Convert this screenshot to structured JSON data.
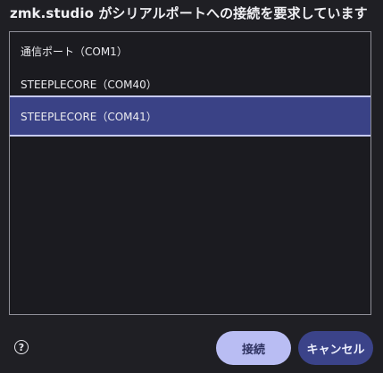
{
  "dialog": {
    "title": "zmk.studio がシリアルポートへの接続を要求しています"
  },
  "ports": [
    {
      "label": "通信ポート（COM1）",
      "selected": false
    },
    {
      "label": "STEEPLECORE（COM40）",
      "selected": false
    },
    {
      "label": "STEEPLECORE（COM41）",
      "selected": true
    }
  ],
  "footer": {
    "help_glyph": "?",
    "connect_label": "接続",
    "cancel_label": "キャンセル"
  },
  "colors": {
    "background": "#1f1f24",
    "selected_row": "#3a4286",
    "primary_button": "#b9bdf3",
    "secondary_button": "#3b4389"
  }
}
